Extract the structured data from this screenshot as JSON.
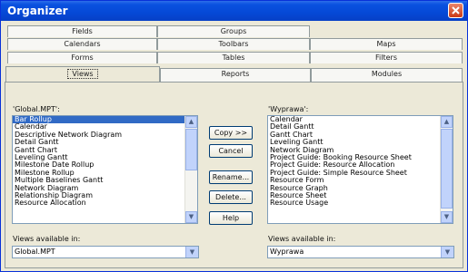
{
  "window": {
    "title": "Organizer"
  },
  "tabs": {
    "row1": [
      "Fields",
      "Groups"
    ],
    "row2": [
      "Calendars",
      "Toolbars",
      "Maps"
    ],
    "row3": [
      "Forms",
      "Tables",
      "Filters"
    ],
    "row4": [
      "Views",
      "Reports",
      "Modules"
    ],
    "active": "Views"
  },
  "left": {
    "label": "'Global.MPT':",
    "items": [
      "Bar Rollup",
      "Calendar",
      "Descriptive Network Diagram",
      "Detail Gantt",
      "Gantt Chart",
      "Leveling Gantt",
      "Milestone Date Rollup",
      "Milestone Rollup",
      "Multiple Baselines Gantt",
      "Network Diagram",
      "Relationship Diagram",
      "Resource Allocation"
    ],
    "selected_index": 0,
    "available_label": "Views available in:",
    "available_value": "Global.MPT"
  },
  "right": {
    "label": "'Wyprawa':",
    "items": [
      "Calendar",
      "Detail Gantt",
      "Gantt Chart",
      "Leveling Gantt",
      "Network Diagram",
      "Project Guide: Booking Resource Sheet",
      "Project Guide: Resource Allocation",
      "Project Guide: Simple Resource Sheet",
      "Resource Form",
      "Resource Graph",
      "Resource Sheet",
      "Resource Usage"
    ],
    "available_label": "Views available in:",
    "available_value": "Wyprawa"
  },
  "buttons": {
    "copy": "Copy >>",
    "cancel": "Cancel",
    "rename": "Rename...",
    "delete": "Delete...",
    "help": "Help"
  },
  "icons": {
    "close": "close-icon",
    "scroll_up": "scroll-up-icon",
    "scroll_down": "scroll-down-icon",
    "dropdown": "chevron-down-icon"
  }
}
